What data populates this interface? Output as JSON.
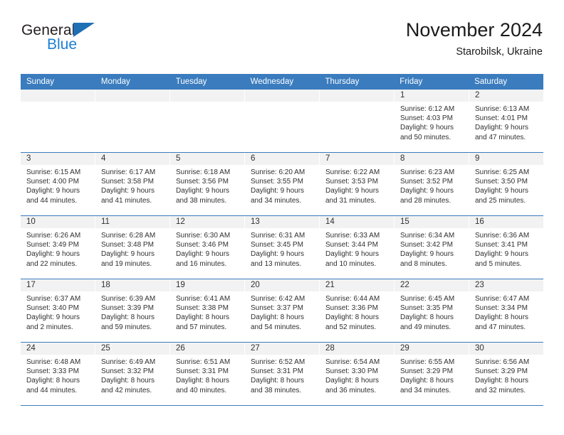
{
  "brand": {
    "name_part1": "General",
    "name_part2": "Blue",
    "logo_icon": "triangle-icon"
  },
  "header": {
    "title": "November 2024",
    "subtitle": "Starobilsk, Ukraine"
  },
  "calendar": {
    "weekdays": [
      "Sunday",
      "Monday",
      "Tuesday",
      "Wednesday",
      "Thursday",
      "Friday",
      "Saturday"
    ],
    "accent_color": "#3a7cbe",
    "day_header_bg": "#f2f2f2",
    "weeks": [
      [
        {
          "day": "",
          "sunrise": "",
          "sunset": "",
          "daylight_line1": "",
          "daylight_line2": ""
        },
        {
          "day": "",
          "sunrise": "",
          "sunset": "",
          "daylight_line1": "",
          "daylight_line2": ""
        },
        {
          "day": "",
          "sunrise": "",
          "sunset": "",
          "daylight_line1": "",
          "daylight_line2": ""
        },
        {
          "day": "",
          "sunrise": "",
          "sunset": "",
          "daylight_line1": "",
          "daylight_line2": ""
        },
        {
          "day": "",
          "sunrise": "",
          "sunset": "",
          "daylight_line1": "",
          "daylight_line2": ""
        },
        {
          "day": "1",
          "sunrise": "Sunrise: 6:12 AM",
          "sunset": "Sunset: 4:03 PM",
          "daylight_line1": "Daylight: 9 hours",
          "daylight_line2": "and 50 minutes."
        },
        {
          "day": "2",
          "sunrise": "Sunrise: 6:13 AM",
          "sunset": "Sunset: 4:01 PM",
          "daylight_line1": "Daylight: 9 hours",
          "daylight_line2": "and 47 minutes."
        }
      ],
      [
        {
          "day": "3",
          "sunrise": "Sunrise: 6:15 AM",
          "sunset": "Sunset: 4:00 PM",
          "daylight_line1": "Daylight: 9 hours",
          "daylight_line2": "and 44 minutes."
        },
        {
          "day": "4",
          "sunrise": "Sunrise: 6:17 AM",
          "sunset": "Sunset: 3:58 PM",
          "daylight_line1": "Daylight: 9 hours",
          "daylight_line2": "and 41 minutes."
        },
        {
          "day": "5",
          "sunrise": "Sunrise: 6:18 AM",
          "sunset": "Sunset: 3:56 PM",
          "daylight_line1": "Daylight: 9 hours",
          "daylight_line2": "and 38 minutes."
        },
        {
          "day": "6",
          "sunrise": "Sunrise: 6:20 AM",
          "sunset": "Sunset: 3:55 PM",
          "daylight_line1": "Daylight: 9 hours",
          "daylight_line2": "and 34 minutes."
        },
        {
          "day": "7",
          "sunrise": "Sunrise: 6:22 AM",
          "sunset": "Sunset: 3:53 PM",
          "daylight_line1": "Daylight: 9 hours",
          "daylight_line2": "and 31 minutes."
        },
        {
          "day": "8",
          "sunrise": "Sunrise: 6:23 AM",
          "sunset": "Sunset: 3:52 PM",
          "daylight_line1": "Daylight: 9 hours",
          "daylight_line2": "and 28 minutes."
        },
        {
          "day": "9",
          "sunrise": "Sunrise: 6:25 AM",
          "sunset": "Sunset: 3:50 PM",
          "daylight_line1": "Daylight: 9 hours",
          "daylight_line2": "and 25 minutes."
        }
      ],
      [
        {
          "day": "10",
          "sunrise": "Sunrise: 6:26 AM",
          "sunset": "Sunset: 3:49 PM",
          "daylight_line1": "Daylight: 9 hours",
          "daylight_line2": "and 22 minutes."
        },
        {
          "day": "11",
          "sunrise": "Sunrise: 6:28 AM",
          "sunset": "Sunset: 3:48 PM",
          "daylight_line1": "Daylight: 9 hours",
          "daylight_line2": "and 19 minutes."
        },
        {
          "day": "12",
          "sunrise": "Sunrise: 6:30 AM",
          "sunset": "Sunset: 3:46 PM",
          "daylight_line1": "Daylight: 9 hours",
          "daylight_line2": "and 16 minutes."
        },
        {
          "day": "13",
          "sunrise": "Sunrise: 6:31 AM",
          "sunset": "Sunset: 3:45 PM",
          "daylight_line1": "Daylight: 9 hours",
          "daylight_line2": "and 13 minutes."
        },
        {
          "day": "14",
          "sunrise": "Sunrise: 6:33 AM",
          "sunset": "Sunset: 3:44 PM",
          "daylight_line1": "Daylight: 9 hours",
          "daylight_line2": "and 10 minutes."
        },
        {
          "day": "15",
          "sunrise": "Sunrise: 6:34 AM",
          "sunset": "Sunset: 3:42 PM",
          "daylight_line1": "Daylight: 9 hours",
          "daylight_line2": "and 8 minutes."
        },
        {
          "day": "16",
          "sunrise": "Sunrise: 6:36 AM",
          "sunset": "Sunset: 3:41 PM",
          "daylight_line1": "Daylight: 9 hours",
          "daylight_line2": "and 5 minutes."
        }
      ],
      [
        {
          "day": "17",
          "sunrise": "Sunrise: 6:37 AM",
          "sunset": "Sunset: 3:40 PM",
          "daylight_line1": "Daylight: 9 hours",
          "daylight_line2": "and 2 minutes."
        },
        {
          "day": "18",
          "sunrise": "Sunrise: 6:39 AM",
          "sunset": "Sunset: 3:39 PM",
          "daylight_line1": "Daylight: 8 hours",
          "daylight_line2": "and 59 minutes."
        },
        {
          "day": "19",
          "sunrise": "Sunrise: 6:41 AM",
          "sunset": "Sunset: 3:38 PM",
          "daylight_line1": "Daylight: 8 hours",
          "daylight_line2": "and 57 minutes."
        },
        {
          "day": "20",
          "sunrise": "Sunrise: 6:42 AM",
          "sunset": "Sunset: 3:37 PM",
          "daylight_line1": "Daylight: 8 hours",
          "daylight_line2": "and 54 minutes."
        },
        {
          "day": "21",
          "sunrise": "Sunrise: 6:44 AM",
          "sunset": "Sunset: 3:36 PM",
          "daylight_line1": "Daylight: 8 hours",
          "daylight_line2": "and 52 minutes."
        },
        {
          "day": "22",
          "sunrise": "Sunrise: 6:45 AM",
          "sunset": "Sunset: 3:35 PM",
          "daylight_line1": "Daylight: 8 hours",
          "daylight_line2": "and 49 minutes."
        },
        {
          "day": "23",
          "sunrise": "Sunrise: 6:47 AM",
          "sunset": "Sunset: 3:34 PM",
          "daylight_line1": "Daylight: 8 hours",
          "daylight_line2": "and 47 minutes."
        }
      ],
      [
        {
          "day": "24",
          "sunrise": "Sunrise: 6:48 AM",
          "sunset": "Sunset: 3:33 PM",
          "daylight_line1": "Daylight: 8 hours",
          "daylight_line2": "and 44 minutes."
        },
        {
          "day": "25",
          "sunrise": "Sunrise: 6:49 AM",
          "sunset": "Sunset: 3:32 PM",
          "daylight_line1": "Daylight: 8 hours",
          "daylight_line2": "and 42 minutes."
        },
        {
          "day": "26",
          "sunrise": "Sunrise: 6:51 AM",
          "sunset": "Sunset: 3:31 PM",
          "daylight_line1": "Daylight: 8 hours",
          "daylight_line2": "and 40 minutes."
        },
        {
          "day": "27",
          "sunrise": "Sunrise: 6:52 AM",
          "sunset": "Sunset: 3:31 PM",
          "daylight_line1": "Daylight: 8 hours",
          "daylight_line2": "and 38 minutes."
        },
        {
          "day": "28",
          "sunrise": "Sunrise: 6:54 AM",
          "sunset": "Sunset: 3:30 PM",
          "daylight_line1": "Daylight: 8 hours",
          "daylight_line2": "and 36 minutes."
        },
        {
          "day": "29",
          "sunrise": "Sunrise: 6:55 AM",
          "sunset": "Sunset: 3:29 PM",
          "daylight_line1": "Daylight: 8 hours",
          "daylight_line2": "and 34 minutes."
        },
        {
          "day": "30",
          "sunrise": "Sunrise: 6:56 AM",
          "sunset": "Sunset: 3:29 PM",
          "daylight_line1": "Daylight: 8 hours",
          "daylight_line2": "and 32 minutes."
        }
      ]
    ]
  }
}
